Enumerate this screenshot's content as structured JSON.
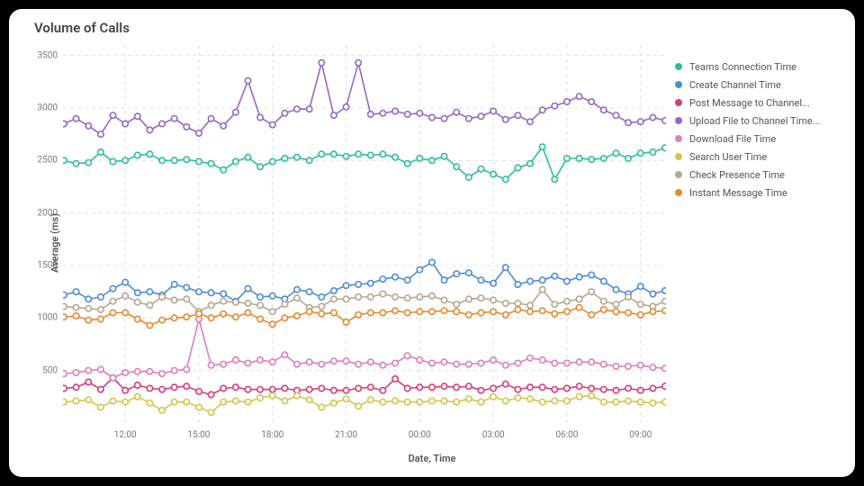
{
  "title": "Volume of Calls",
  "axes": {
    "ylabel": "Average (ms)",
    "xlabel": "Date, Time"
  },
  "chart_data": {
    "type": "line",
    "ylabel": "Average (ms)",
    "xlabel": "Date, Time",
    "title": "Volume of Calls",
    "ylim": [
      0,
      3600
    ],
    "y_ticks": [
      500,
      1000,
      1500,
      2000,
      2500,
      3000,
      3500
    ],
    "x_ticks": [
      "12:00",
      "15:00",
      "18:00",
      "21:00",
      "00:00",
      "03:00",
      "06:00",
      "09:00"
    ],
    "x": [
      0,
      1,
      2,
      3,
      4,
      5,
      6,
      7,
      8,
      9,
      10,
      11,
      12,
      13,
      14,
      15,
      16,
      17,
      18,
      19,
      20,
      21,
      22,
      23,
      24,
      25,
      26,
      27,
      28,
      29,
      30,
      31,
      32,
      33,
      34,
      35,
      36,
      37,
      38,
      39,
      40,
      41,
      42,
      43,
      44,
      45,
      46,
      47,
      48,
      49
    ],
    "x_tick_positions": [
      5,
      11,
      17,
      23,
      29,
      35,
      41,
      47
    ],
    "x_range": [
      0,
      49
    ],
    "series": [
      {
        "name": "Teams Connection Time",
        "color": "#2dbf9a",
        "values": [
          2500,
          2470,
          2480,
          2580,
          2490,
          2500,
          2550,
          2560,
          2500,
          2500,
          2510,
          2490,
          2470,
          2410,
          2490,
          2530,
          2440,
          2490,
          2520,
          2530,
          2500,
          2560,
          2560,
          2540,
          2560,
          2550,
          2560,
          2530,
          2470,
          2520,
          2500,
          2540,
          2440,
          2340,
          2420,
          2370,
          2320,
          2430,
          2470,
          2630,
          2320,
          2520,
          2520,
          2510,
          2520,
          2570,
          2520,
          2570,
          2580,
          2620
        ]
      },
      {
        "name": "Create Channel Time",
        "color": "#4f8dd6",
        "values": [
          1220,
          1250,
          1180,
          1200,
          1280,
          1340,
          1240,
          1250,
          1220,
          1320,
          1290,
          1250,
          1240,
          1230,
          1160,
          1280,
          1200,
          1210,
          1180,
          1270,
          1250,
          1200,
          1260,
          1310,
          1320,
          1330,
          1370,
          1390,
          1360,
          1460,
          1530,
          1360,
          1420,
          1430,
          1360,
          1330,
          1480,
          1320,
          1350,
          1360,
          1400,
          1350,
          1390,
          1410,
          1350,
          1270,
          1230,
          1300,
          1230,
          1260
        ]
      },
      {
        "name": "Post Message to Channel...",
        "color": "#d83d7a",
        "values": [
          330,
          340,
          390,
          320,
          430,
          310,
          360,
          330,
          320,
          340,
          350,
          300,
          270,
          330,
          340,
          320,
          320,
          320,
          330,
          310,
          320,
          330,
          310,
          310,
          330,
          340,
          310,
          420,
          330,
          340,
          340,
          350,
          340,
          350,
          310,
          330,
          370,
          320,
          340,
          340,
          320,
          330,
          350,
          330,
          320,
          310,
          330,
          310,
          330,
          350
        ]
      },
      {
        "name": "Upload File to Channel Time...",
        "color": "#8e6cc5",
        "values": [
          2850,
          2900,
          2830,
          2750,
          2930,
          2850,
          2920,
          2790,
          2850,
          2900,
          2820,
          2760,
          2900,
          2830,
          2960,
          3260,
          2910,
          2840,
          2950,
          2990,
          2990,
          3430,
          2930,
          3010,
          3430,
          2940,
          2950,
          2970,
          2940,
          2950,
          2910,
          2900,
          2960,
          2900,
          2920,
          2970,
          2890,
          2930,
          2870,
          2980,
          3020,
          3060,
          3110,
          3060,
          2980,
          2930,
          2860,
          2870,
          2910,
          2880
        ]
      },
      {
        "name": "Download File Time",
        "color": "#e07fb8",
        "values": [
          470,
          480,
          500,
          510,
          430,
          480,
          490,
          490,
          470,
          500,
          510,
          990,
          550,
          560,
          600,
          570,
          600,
          580,
          650,
          560,
          580,
          560,
          590,
          590,
          560,
          580,
          550,
          570,
          640,
          600,
          570,
          580,
          560,
          560,
          570,
          600,
          550,
          570,
          620,
          600,
          570,
          570,
          580,
          580,
          560,
          540,
          540,
          550,
          530,
          520
        ]
      },
      {
        "name": "Search User Time",
        "color": "#cfc84a",
        "values": [
          200,
          210,
          220,
          150,
          210,
          200,
          250,
          190,
          120,
          200,
          200,
          150,
          100,
          200,
          210,
          200,
          240,
          260,
          210,
          260,
          220,
          150,
          190,
          230,
          160,
          220,
          200,
          210,
          200,
          200,
          210,
          210,
          200,
          230,
          200,
          250,
          210,
          240,
          230,
          200,
          210,
          210,
          250,
          260,
          200,
          200,
          210,
          200,
          190,
          200
        ]
      },
      {
        "name": "Check Presence Time",
        "color": "#b1a994",
        "values": [
          1110,
          1100,
          1090,
          1080,
          1160,
          1210,
          1150,
          1120,
          1200,
          1170,
          1180,
          1060,
          1120,
          1160,
          1150,
          1140,
          1120,
          1060,
          1130,
          1190,
          1100,
          1110,
          1180,
          1180,
          1200,
          1200,
          1230,
          1200,
          1190,
          1200,
          1210,
          1170,
          1130,
          1180,
          1190,
          1170,
          1140,
          1140,
          1120,
          1270,
          1130,
          1160,
          1180,
          1250,
          1160,
          1130,
          1200,
          1130,
          1110,
          1160
        ]
      },
      {
        "name": "Instant Message Time",
        "color": "#e68a2e",
        "values": [
          1010,
          1020,
          980,
          990,
          1050,
          1050,
          990,
          930,
          980,
          1000,
          1010,
          1040,
          1000,
          1040,
          1010,
          1050,
          990,
          940,
          1000,
          1020,
          1060,
          1040,
          1050,
          960,
          1030,
          1050,
          1050,
          1070,
          1050,
          1060,
          1060,
          1070,
          1060,
          1030,
          1050,
          1060,
          1030,
          1080,
          1060,
          1070,
          1040,
          1060,
          1100,
          1030,
          1080,
          1060,
          1050,
          1030,
          1060,
          1070
        ]
      }
    ],
    "legend_position": "right"
  }
}
